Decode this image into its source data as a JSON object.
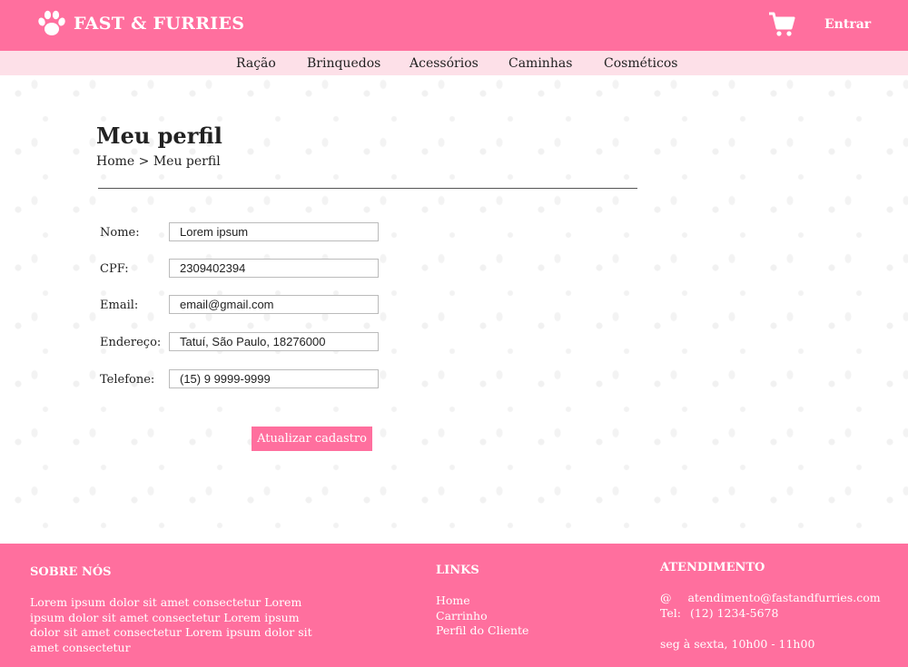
{
  "header": {
    "brand": "FAST & FURRIES",
    "login_label": "Entrar"
  },
  "categories": [
    "Ração",
    "Brinquedos",
    "Acessórios",
    "Caminhas",
    "Cosméticos"
  ],
  "page": {
    "title": "Meu perfil",
    "breadcrumb": "Home > Meu perfil"
  },
  "form": {
    "fields": [
      {
        "label": "Nome:",
        "value": "Lorem ipsum"
      },
      {
        "label": "CPF:",
        "value": "2309402394"
      },
      {
        "label": "Email:",
        "value": "email@gmail.com"
      },
      {
        "label": "Endereço:",
        "value": "Tatuí, São Paulo, 18276000"
      },
      {
        "label": "Telefone:",
        "value": "(15) 9 9999-9999"
      }
    ],
    "submit_label": "Atualizar cadastro"
  },
  "footer": {
    "about": {
      "heading": "SOBRE NÓS",
      "text": "Lorem ipsum dolor sit amet consectetur Lorem ipsum dolor sit amet consectetur Lorem ipsum dolor sit amet consectetur Lorem ipsum dolor sit amet consectetur"
    },
    "links": {
      "heading": "LINKS",
      "items": [
        "Home",
        "Carrinho",
        "Perfil do Cliente"
      ]
    },
    "support": {
      "heading": "ATENDIMENTO",
      "email_prefix": "@",
      "email": "atendimento@fastandfurries.com",
      "phone_label": "Tel:",
      "phone": "(12) 1234-5678",
      "hours": "seg à sexta, 10h00 - 11h00"
    }
  },
  "colors": {
    "brand_pink": "#ff6f9e",
    "nav_pink": "#fde0e8"
  }
}
